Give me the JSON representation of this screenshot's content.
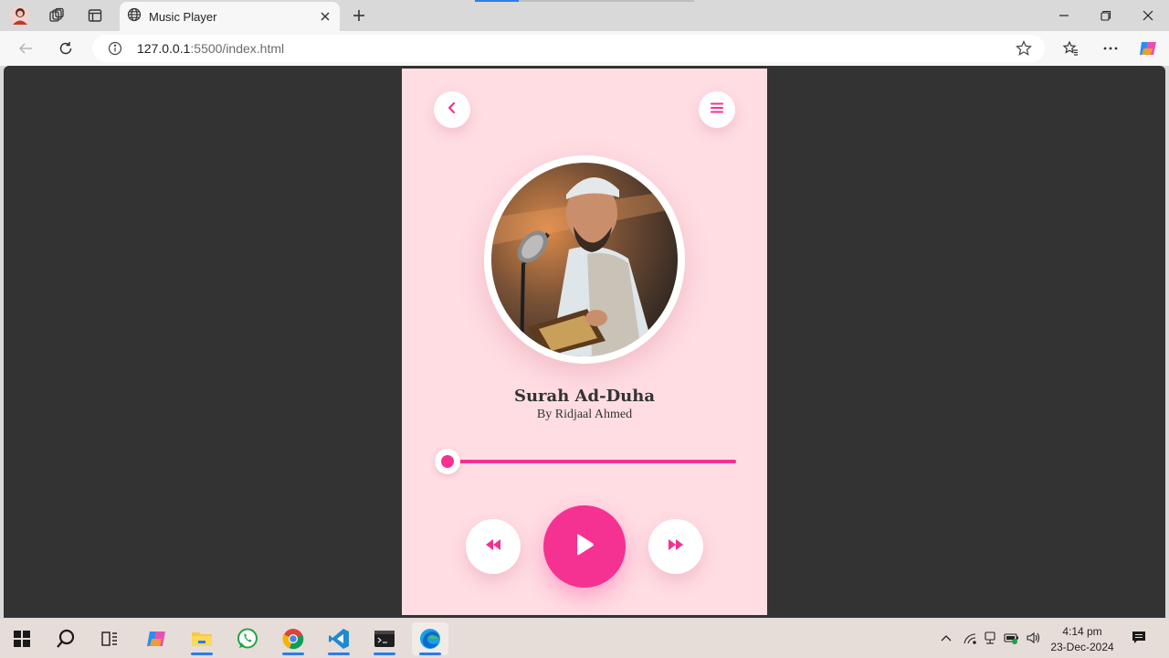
{
  "browser": {
    "tab_title": "Music Player",
    "url_host": "127.0.0.1",
    "url_rest": ":5500/index.html"
  },
  "player": {
    "title": "Surah Ad-Duha",
    "artist": "By Ridjaal Ahmed",
    "progress_fraction": 0.0,
    "accent_color": "#f53191",
    "background_color": "#ffdde3",
    "artwork": "reciter-with-microphone-and-quran"
  },
  "taskbar": {
    "apps": [
      "start-icon",
      "search-icon",
      "task-view-icon",
      "copilot-icon",
      "file-explorer-icon",
      "whatsapp-icon",
      "chrome-icon",
      "vscode-icon",
      "terminal-icon",
      "edge-icon"
    ],
    "time": "4:14 pm",
    "date": "23-Dec-2024"
  }
}
